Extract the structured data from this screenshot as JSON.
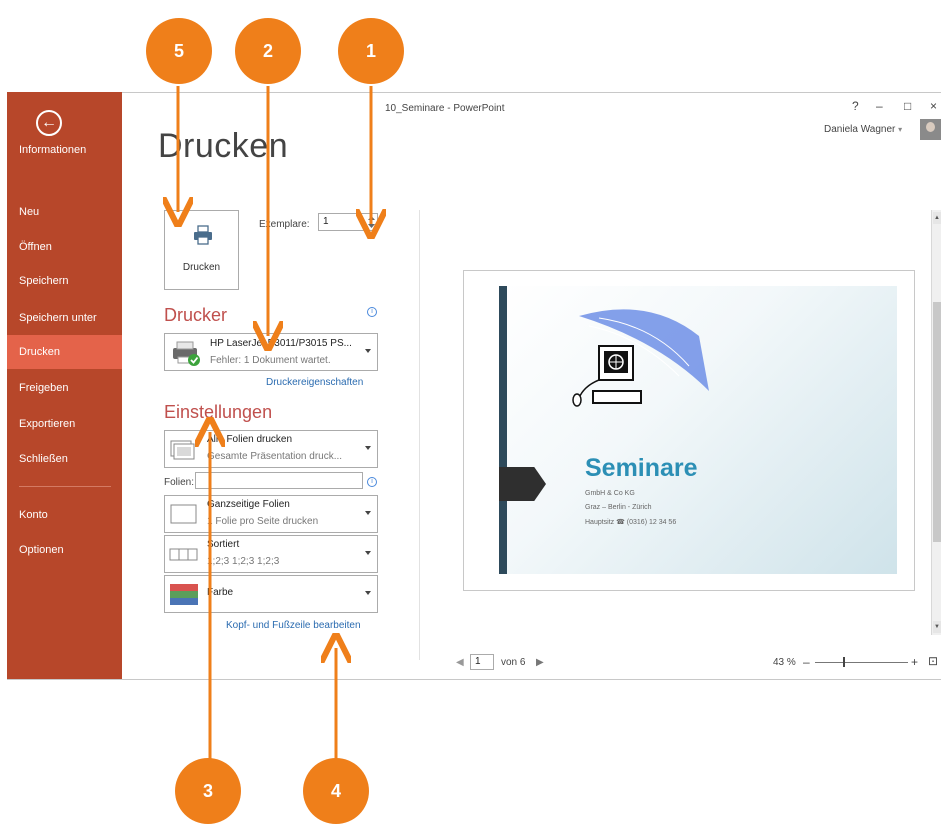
{
  "window": {
    "title": "10_Seminare - PowerPoint",
    "help": "?",
    "minimize": "–",
    "maximize": "□",
    "close": "×",
    "user_name": "Daniela Wagner",
    "user_caret": "▾"
  },
  "backstage": {
    "back_icon": "←",
    "items": [
      {
        "label": "Informationen"
      },
      {
        "label": "Neu"
      },
      {
        "label": "Öffnen"
      },
      {
        "label": "Speichern"
      },
      {
        "label": "Speichern unter"
      },
      {
        "label": "Drucken",
        "active": true
      },
      {
        "label": "Freigeben"
      },
      {
        "label": "Exportieren"
      },
      {
        "label": "Schließen"
      },
      {
        "label": "Konto"
      },
      {
        "label": "Optionen"
      }
    ],
    "color": "#b7472a",
    "active_color": "#e4634a"
  },
  "print": {
    "page_title": "Drucken",
    "print_button_label": "Drucken",
    "copies_label": "Exemplare:",
    "copies_value": "1",
    "printer_section_title": "Drucker",
    "printer_name": "HP LaserJet P3011/P3015 PS...",
    "printer_status": "Fehler: 1 Dokument wartet.",
    "printer_properties_link": "Druckereigenschaften",
    "settings_section_title": "Einstellungen",
    "settings": [
      {
        "line1": "Alle Folien drucken",
        "line2": "Gesamte Präsentation druck..."
      },
      {
        "line1": "Ganzseitige Folien",
        "line2": "1 Folie pro Seite drucken"
      },
      {
        "line1": "Sortiert",
        "line2": "1;2;3   1;2;3   1;2;3"
      },
      {
        "line1": "Farbe",
        "line2": ""
      }
    ],
    "slides_label": "Folien:",
    "slides_value": "",
    "header_footer_link": "Kopf- und Fußzeile bearbeiten",
    "info_icon": "i"
  },
  "preview": {
    "slide_title": "Seminare",
    "slide_lines": [
      "GmbH & Co KG",
      "Graz – Berlin - Zürich",
      "Hauptsitz ☎ (0316) 12 34 56"
    ],
    "page_prev": "◀",
    "page_current": "1",
    "page_of": "von 6",
    "page_next": "▶",
    "zoom": "43 %",
    "zoom_minus": "–",
    "zoom_plus": "+",
    "zoom_fit_icon": "⊡",
    "zoom_level_fraction": 0.3
  },
  "callouts": [
    {
      "number": "1"
    },
    {
      "number": "2"
    },
    {
      "number": "3"
    },
    {
      "number": "4"
    },
    {
      "number": "5"
    }
  ],
  "callout_color": "#ef7f1a"
}
